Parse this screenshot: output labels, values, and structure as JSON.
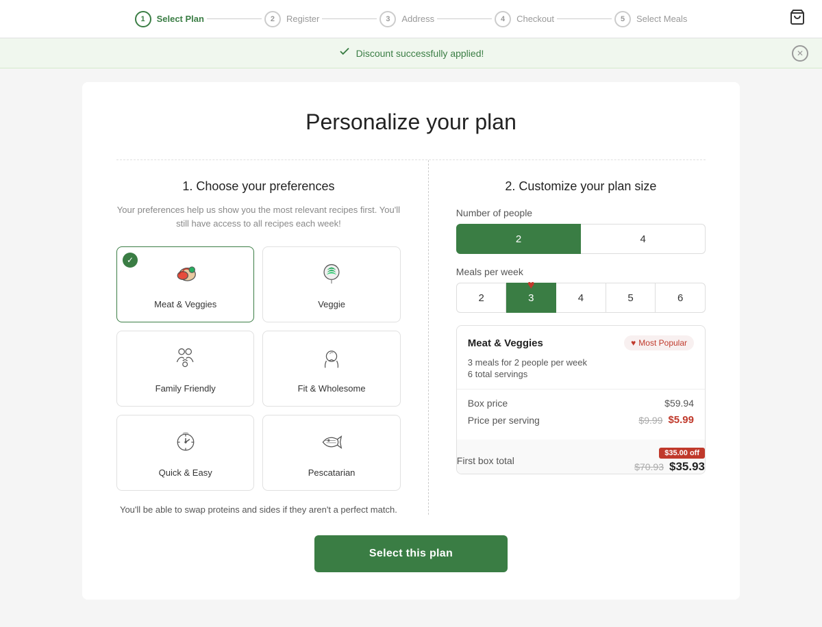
{
  "nav": {
    "steps": [
      {
        "num": "1",
        "label": "Select Plan",
        "active": true
      },
      {
        "num": "2",
        "label": "Register",
        "active": false
      },
      {
        "num": "3",
        "label": "Address",
        "active": false
      },
      {
        "num": "4",
        "label": "Checkout",
        "active": false
      },
      {
        "num": "5",
        "label": "Select Meals",
        "active": false
      }
    ]
  },
  "banner": {
    "message": "Discount successfully applied!"
  },
  "page": {
    "title": "Personalize your plan",
    "left_section": "1. Choose your preferences",
    "left_desc": "Your preferences help us show you the most relevant recipes first. You'll still have access to all recipes each week!",
    "right_section": "2. Customize your plan size",
    "swap_note": "You'll be able to swap proteins and sides if they aren't a perfect match.",
    "cta_label": "Select this plan"
  },
  "preferences": [
    {
      "id": "meat-veggies",
      "label": "Meat & Veggies",
      "selected": true
    },
    {
      "id": "veggie",
      "label": "Veggie",
      "selected": false
    },
    {
      "id": "family-friendly",
      "label": "Family Friendly",
      "selected": false
    },
    {
      "id": "fit-wholesome",
      "label": "Fit & Wholesome",
      "selected": false
    },
    {
      "id": "quick-easy",
      "label": "Quick & Easy",
      "selected": false
    },
    {
      "id": "pescatarian",
      "label": "Pescatarian",
      "selected": false
    }
  ],
  "plan_size": {
    "people_label": "Number of people",
    "people_options": [
      "2",
      "4"
    ],
    "people_selected": "2",
    "meals_label": "Meals per week",
    "meals_options": [
      "2",
      "3",
      "4",
      "5",
      "6"
    ],
    "meals_selected": "3",
    "meals_popular_index": 1
  },
  "summary": {
    "plan_name": "Meat & Veggies",
    "popular_badge": "Most Popular",
    "meals_desc": "3 meals for 2 people per week",
    "servings_desc": "6 total servings",
    "box_price_label": "Box price",
    "box_price": "$59.94",
    "per_serving_label": "Price per serving",
    "per_serving_original": "$9.99",
    "per_serving_new": "$5.99",
    "first_box_label": "First box total",
    "off_badge": "$35.00 off",
    "first_box_original": "$70.93",
    "first_box_new": "$35.93"
  }
}
